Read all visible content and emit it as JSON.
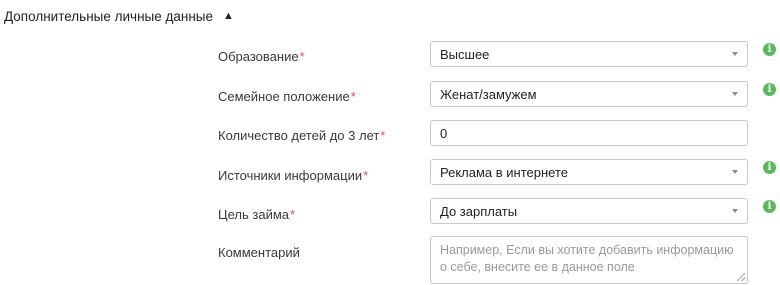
{
  "section": {
    "title": "Дополнительные личные данные",
    "toggle": "▲"
  },
  "fields": [
    {
      "label": "Образование",
      "required": "*",
      "value": "Высшее"
    },
    {
      "label": "Семейное положение",
      "required": "*",
      "value": "Женат/замужем"
    },
    {
      "label": "Количество детей до 3 лет",
      "required": "*",
      "value": "0"
    },
    {
      "label": "Источники информации",
      "required": "*",
      "value": "Реклама в интернете"
    },
    {
      "label": "Цель займа",
      "required": "*",
      "value": "До зарплаты"
    },
    {
      "label": "Комментарий",
      "placeholder": "Например, Если вы хотите добавить информацию о себе, внесите ее в данное поле"
    }
  ],
  "icons": {
    "info": "i",
    "info_color": "#5cb85c",
    "required_color": "#d9534f"
  }
}
